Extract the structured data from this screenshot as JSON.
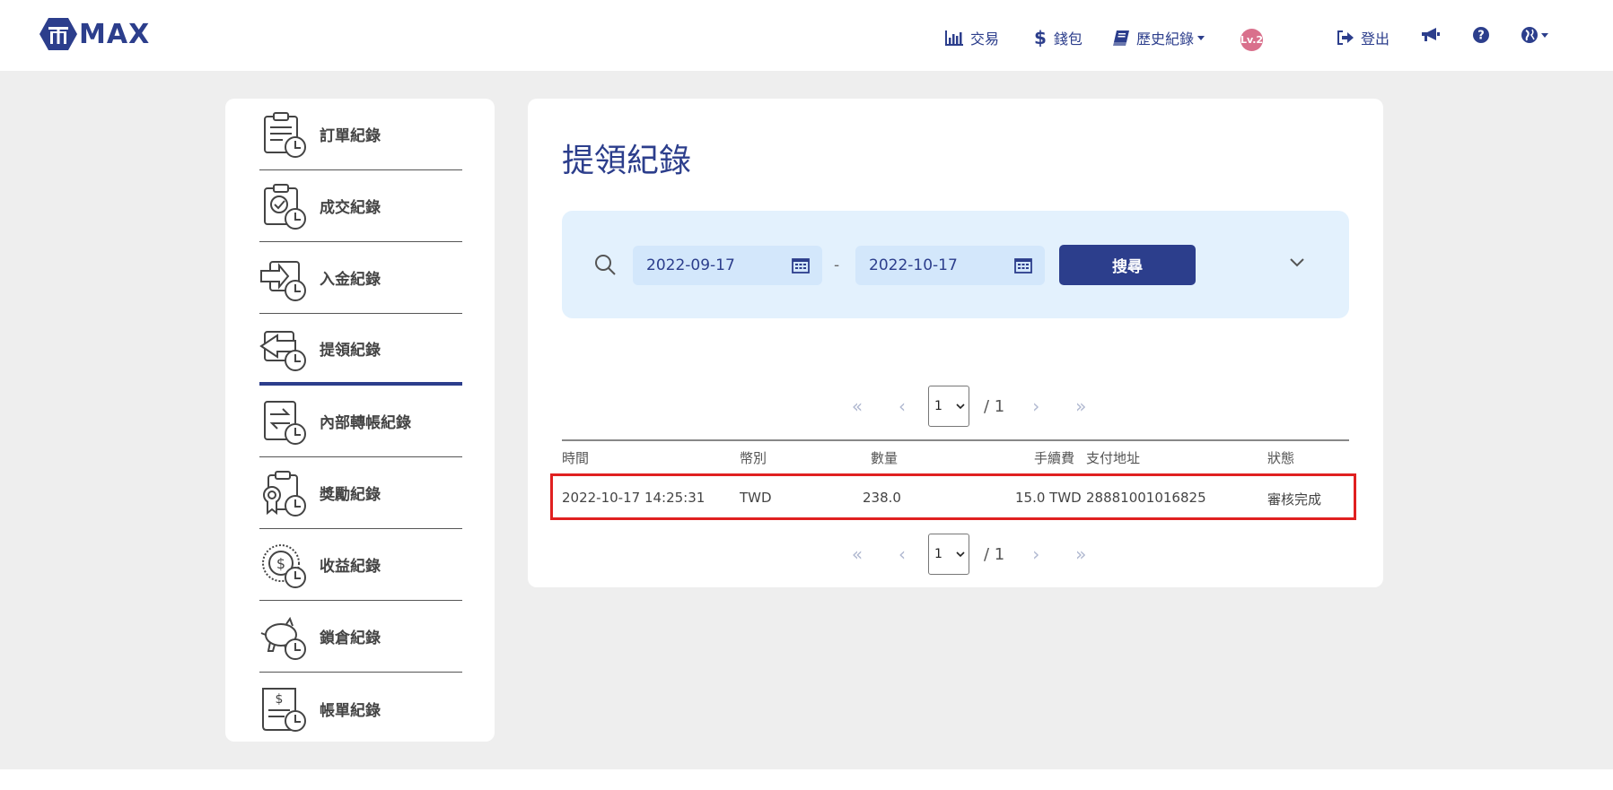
{
  "header": {
    "logo_text": "MAX",
    "nav": {
      "trade": "交易",
      "wallet": "錢包",
      "history": "歷史紀錄",
      "level": "Lv.2",
      "logout": "登出"
    }
  },
  "sidebar": {
    "items": [
      {
        "label": "訂單紀錄",
        "icon": "order-record-icon"
      },
      {
        "label": "成交紀錄",
        "icon": "trade-record-icon"
      },
      {
        "label": "入金紀錄",
        "icon": "deposit-record-icon"
      },
      {
        "label": "提領紀錄",
        "icon": "withdraw-record-icon",
        "active": true
      },
      {
        "label": "內部轉帳紀錄",
        "icon": "internal-transfer-icon"
      },
      {
        "label": "獎勵紀錄",
        "icon": "reward-record-icon"
      },
      {
        "label": "收益紀錄",
        "icon": "income-record-icon"
      },
      {
        "label": "鎖倉紀錄",
        "icon": "lock-record-icon"
      },
      {
        "label": "帳單紀錄",
        "icon": "bill-record-icon"
      }
    ]
  },
  "main": {
    "title": "提領紀錄",
    "filter": {
      "date_from": "2022-09-17",
      "date_to": "2022-10-17",
      "separator": "-",
      "search_label": "搜尋"
    },
    "pager": {
      "page": "1",
      "total": "/ 1"
    },
    "table": {
      "headers": [
        "時間",
        "幣別",
        "數量",
        "手續費",
        "支付地址",
        "狀態"
      ],
      "rows": [
        [
          "2022-10-17 14:25:31",
          "TWD",
          "238.0",
          "15.0 TWD",
          "28881001016825",
          "審核完成"
        ]
      ]
    }
  },
  "colors": {
    "brand": "#2c3e8c",
    "highlight": "#e02020",
    "filter_bg": "#e3f1fd"
  }
}
